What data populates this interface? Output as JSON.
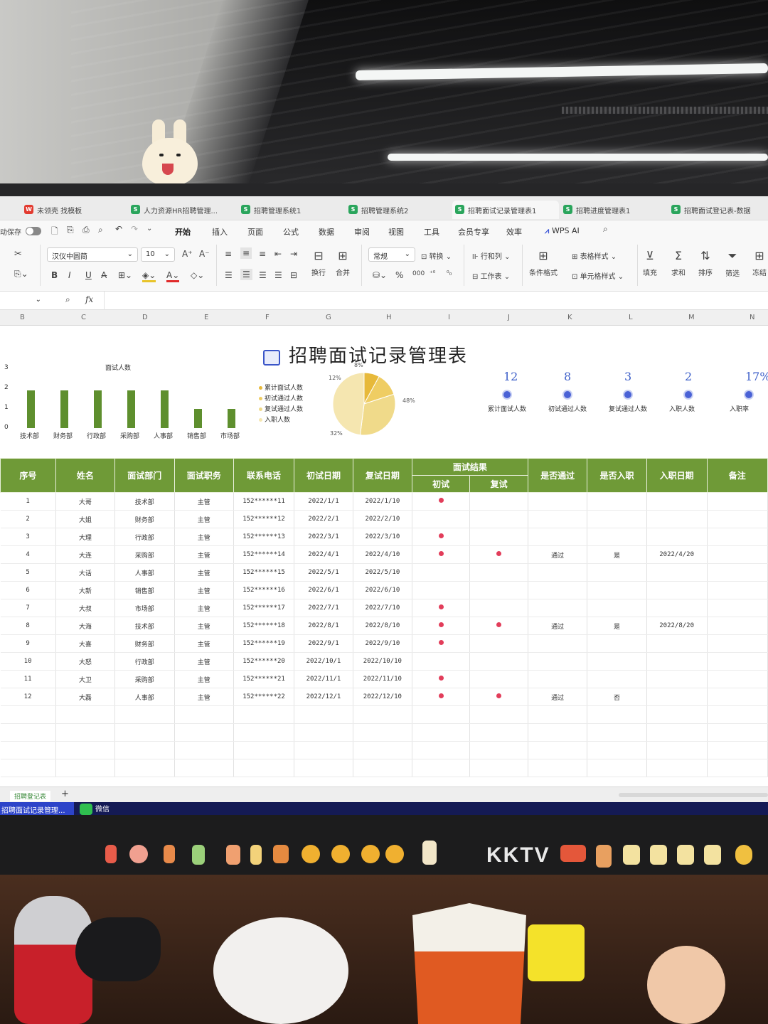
{
  "window_tabs": [
    {
      "label": "未领壳 找模板",
      "icon": "wps-red-icon"
    },
    {
      "label": "人力资源HR招聘管理...",
      "icon": "sheet-green-icon"
    },
    {
      "label": "招聘管理系统1",
      "icon": "sheet-green-icon"
    },
    {
      "label": "招聘管理系统2",
      "icon": "sheet-green-icon"
    },
    {
      "label": "招聘面试记录管理表1",
      "icon": "sheet-green-icon"
    },
    {
      "label": "招聘进度管理表1",
      "icon": "sheet-green-icon"
    },
    {
      "label": "招聘面试登记表-数据",
      "icon": "sheet-green-icon"
    }
  ],
  "menubar": {
    "autosave": "动保存",
    "items": [
      "开始",
      "插入",
      "页面",
      "公式",
      "数据",
      "审阅",
      "视图",
      "工具",
      "会员专享",
      "效率"
    ],
    "wps_ai": "WPS AI"
  },
  "ribbon": {
    "font_name": "汉仪中圆简",
    "font_size": "10",
    "number_format": "常规",
    "convert": "转换",
    "wrap": "换行",
    "merge": "合并",
    "row_col": "行和列",
    "worksheet": "工作表",
    "cond_format": "条件格式",
    "table_style": "表格样式",
    "cell_style": "单元格样式",
    "fill": "填充",
    "sum": "求和",
    "sort": "排序",
    "filter": "筛选",
    "freeze": "冻结"
  },
  "formula_bar": {
    "fx": "fx"
  },
  "columns": [
    "B",
    "C",
    "D",
    "E",
    "F",
    "G",
    "H",
    "I",
    "J",
    "K",
    "L",
    "M",
    "N"
  ],
  "title": "招聘面试记录管理表",
  "chart_data": [
    {
      "type": "bar",
      "title": "面试人数",
      "categories": [
        "技术部",
        "财务部",
        "行政部",
        "采购部",
        "人事部",
        "销售部",
        "市场部"
      ],
      "values": [
        2,
        2,
        2,
        2,
        2,
        1,
        1
      ],
      "ylim": [
        0,
        3
      ],
      "yticks": [
        "0",
        "1",
        "2",
        "3"
      ]
    },
    {
      "type": "pie",
      "legend": [
        "累计面试人数",
        "初试通过人数",
        "复试通过人数",
        "入职人数"
      ],
      "labels": [
        "8%",
        "12%",
        "32%",
        "48%"
      ],
      "values": [
        8,
        12,
        32,
        48
      ],
      "colors": [
        "#e7b93a",
        "#efcd63",
        "#f0da8a",
        "#f5e6b0"
      ]
    }
  ],
  "kpis": [
    {
      "value": "12",
      "label": "累计面试人数"
    },
    {
      "value": "8",
      "label": "初试通过人数"
    },
    {
      "value": "3",
      "label": "复试通过人数"
    },
    {
      "value": "2",
      "label": "入职人数"
    },
    {
      "value": "17%",
      "label": "入职率"
    }
  ],
  "table": {
    "headers": [
      "序号",
      "姓名",
      "面试部门",
      "面试职务",
      "联系电话",
      "初试日期",
      "复试日期",
      "面试结果",
      "是否通过",
      "是否入职",
      "入职日期",
      "备注"
    ],
    "sub_headers": [
      "初试",
      "复试"
    ],
    "rows": [
      {
        "no": "1",
        "name": "大哥",
        "dept": "技术部",
        "job": "主管",
        "phone": "152******11",
        "d1": "2022/1/1",
        "d2": "2022/1/10",
        "r1": true,
        "r2": false,
        "pass": "",
        "join": "",
        "jdate": ""
      },
      {
        "no": "2",
        "name": "大姐",
        "dept": "财务部",
        "job": "主管",
        "phone": "152******12",
        "d1": "2022/2/1",
        "d2": "2022/2/10",
        "r1": false,
        "r2": false,
        "pass": "",
        "join": "",
        "jdate": ""
      },
      {
        "no": "3",
        "name": "大理",
        "dept": "行政部",
        "job": "主管",
        "phone": "152******13",
        "d1": "2022/3/1",
        "d2": "2022/3/10",
        "r1": true,
        "r2": false,
        "pass": "",
        "join": "",
        "jdate": ""
      },
      {
        "no": "4",
        "name": "大连",
        "dept": "采购部",
        "job": "主管",
        "phone": "152******14",
        "d1": "2022/4/1",
        "d2": "2022/4/10",
        "r1": true,
        "r2": true,
        "pass": "通过",
        "join": "是",
        "jdate": "2022/4/20"
      },
      {
        "no": "5",
        "name": "大话",
        "dept": "人事部",
        "job": "主管",
        "phone": "152******15",
        "d1": "2022/5/1",
        "d2": "2022/5/10",
        "r1": false,
        "r2": false,
        "pass": "",
        "join": "",
        "jdate": ""
      },
      {
        "no": "6",
        "name": "大新",
        "dept": "销售部",
        "job": "主管",
        "phone": "152******16",
        "d1": "2022/6/1",
        "d2": "2022/6/10",
        "r1": false,
        "r2": false,
        "pass": "",
        "join": "",
        "jdate": ""
      },
      {
        "no": "7",
        "name": "大叔",
        "dept": "市场部",
        "job": "主管",
        "phone": "152******17",
        "d1": "2022/7/1",
        "d2": "2022/7/10",
        "r1": true,
        "r2": false,
        "pass": "",
        "join": "",
        "jdate": ""
      },
      {
        "no": "8",
        "name": "大海",
        "dept": "技术部",
        "job": "主管",
        "phone": "152******18",
        "d1": "2022/8/1",
        "d2": "2022/8/10",
        "r1": true,
        "r2": true,
        "pass": "通过",
        "join": "是",
        "jdate": "2022/8/20"
      },
      {
        "no": "9",
        "name": "大喜",
        "dept": "财务部",
        "job": "主管",
        "phone": "152******19",
        "d1": "2022/9/1",
        "d2": "2022/9/10",
        "r1": true,
        "r2": false,
        "pass": "",
        "join": "",
        "jdate": ""
      },
      {
        "no": "10",
        "name": "大怒",
        "dept": "行政部",
        "job": "主管",
        "phone": "152******20",
        "d1": "2022/10/1",
        "d2": "2022/10/10",
        "r1": false,
        "r2": false,
        "pass": "",
        "join": "",
        "jdate": ""
      },
      {
        "no": "11",
        "name": "大卫",
        "dept": "采购部",
        "job": "主管",
        "phone": "152******21",
        "d1": "2022/11/1",
        "d2": "2022/11/10",
        "r1": true,
        "r2": false,
        "pass": "",
        "join": "",
        "jdate": ""
      },
      {
        "no": "12",
        "name": "大磊",
        "dept": "人事部",
        "job": "主管",
        "phone": "152******22",
        "d1": "2022/12/1",
        "d2": "2022/12/10",
        "r1": true,
        "r2": true,
        "pass": "通过",
        "join": "否",
        "jdate": ""
      }
    ]
  },
  "sheet_tab": "招聘登记表",
  "taskbar": {
    "app": "招聘面试记录管理...",
    "wechat": "微信"
  },
  "brand": "KKTV",
  "colors": {
    "header_green": "#6f9a37",
    "bar_green": "#5e8f2e",
    "kpi_blue": "#3d5fc9",
    "dot_red": "#e23d5a"
  }
}
